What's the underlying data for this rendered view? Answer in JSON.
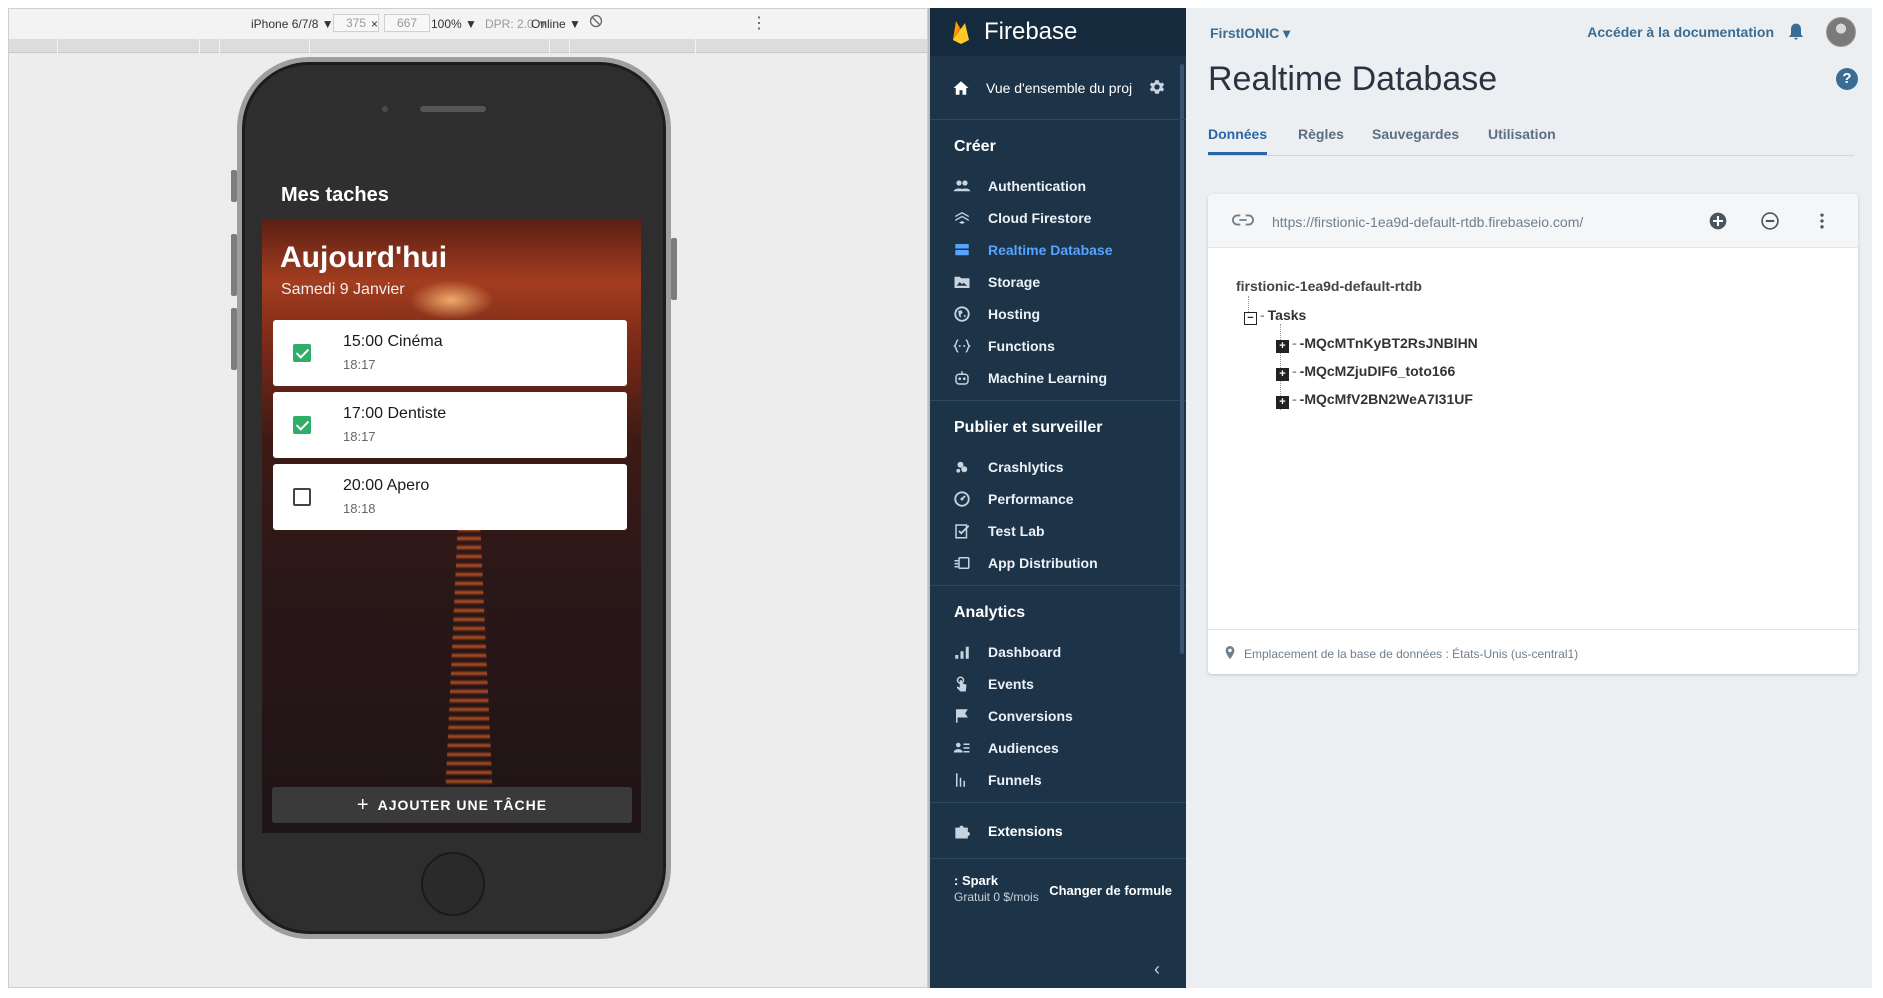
{
  "devtools": {
    "device": "iPhone 6/7/8 ▼",
    "width": "375",
    "times": "×",
    "height": "667",
    "zoom": "100% ▼",
    "dpr": "DPR: 2.0 ▼",
    "network": "Online ▼"
  },
  "app": {
    "header_title": "Mes taches",
    "day_title": "Aujourd'hui",
    "day_date": "Samedi 9 Janvier",
    "tasks": [
      {
        "title": "15:00 Cinéma",
        "time": "18:17",
        "done": true
      },
      {
        "title": "17:00 Dentiste",
        "time": "18:17",
        "done": true
      },
      {
        "title": "20:00 Apero",
        "time": "18:18",
        "done": false
      }
    ],
    "add_button": "AJOUTER UNE TÂCHE"
  },
  "sidebar": {
    "brand": "Firebase",
    "overview": "Vue d'ensemble du proj",
    "sections": [
      {
        "title": "Créer",
        "items": [
          {
            "label": "Authentication",
            "icon": "people-icon"
          },
          {
            "label": "Cloud Firestore",
            "icon": "firestore-icon"
          },
          {
            "label": "Realtime Database",
            "icon": "database-icon",
            "active": true
          },
          {
            "label": "Storage",
            "icon": "storage-icon"
          },
          {
            "label": "Hosting",
            "icon": "hosting-icon"
          },
          {
            "label": "Functions",
            "icon": "functions-icon"
          },
          {
            "label": "Machine Learning",
            "icon": "robot-icon"
          }
        ]
      },
      {
        "title": "Publier et surveiller",
        "items": [
          {
            "label": "Crashlytics",
            "icon": "crashlytics-icon"
          },
          {
            "label": "Performance",
            "icon": "performance-icon"
          },
          {
            "label": "Test Lab",
            "icon": "testlab-icon"
          },
          {
            "label": "App Distribution",
            "icon": "app-distribution-icon"
          }
        ]
      },
      {
        "title": "Analytics",
        "items": [
          {
            "label": "Dashboard",
            "icon": "bar-chart-icon"
          },
          {
            "label": "Events",
            "icon": "touch-icon"
          },
          {
            "label": "Conversions",
            "icon": "flag-icon"
          },
          {
            "label": "Audiences",
            "icon": "audiences-icon"
          },
          {
            "label": "Funnels",
            "icon": "funnels-icon"
          }
        ]
      }
    ],
    "extensions": "Extensions",
    "plan_name": ": Spark",
    "plan_price": "Gratuit 0 $/mois",
    "change_plan": "Changer de formule",
    "accent_color": "#56a4ff"
  },
  "main": {
    "project": "FirstIONIC ▾",
    "docs_link": "Accéder à la documentation",
    "title": "Realtime Database",
    "tabs": [
      "Données",
      "Règles",
      "Sauvegardes",
      "Utilisation"
    ],
    "active_tab": 0,
    "db_url": "https://firstionic-1ea9d-default-rtdb.firebaseio.com/",
    "root": "firstionic-1ea9d-default-rtdb",
    "node": "Tasks",
    "children": [
      "-MQcMTnKyBT2RsJNBlHN",
      "-MQcMZjuDIF6_toto166",
      "-MQcMfV2BN2WeA7I31UF"
    ],
    "location": "Emplacement de la base de données : États-Unis (us-central1)"
  }
}
